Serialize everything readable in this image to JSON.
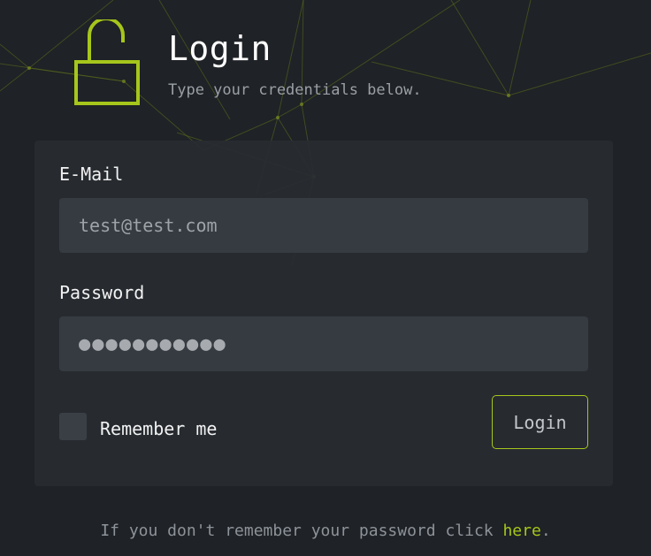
{
  "header": {
    "title": "Login",
    "subtitle": "Type your credentials below."
  },
  "form": {
    "email_label": "E-Mail",
    "email_placeholder": "test@test.com",
    "password_label": "Password",
    "password_placeholder": "●●●●●●●●●●●",
    "remember_label": "Remember me",
    "remember_checked": false,
    "login_label": "Login"
  },
  "footer": {
    "text_before": "If you don't remember your password click ",
    "link_label": "here",
    "text_after": "."
  },
  "icons": {
    "header_icon": "unlocked-padlock-icon"
  },
  "colors": {
    "background": "#1f2226",
    "card": "#282c31",
    "input": "#363b42",
    "accent": "#a6c61b",
    "text": "#f2f2f2",
    "muted": "#9aa0a6"
  }
}
